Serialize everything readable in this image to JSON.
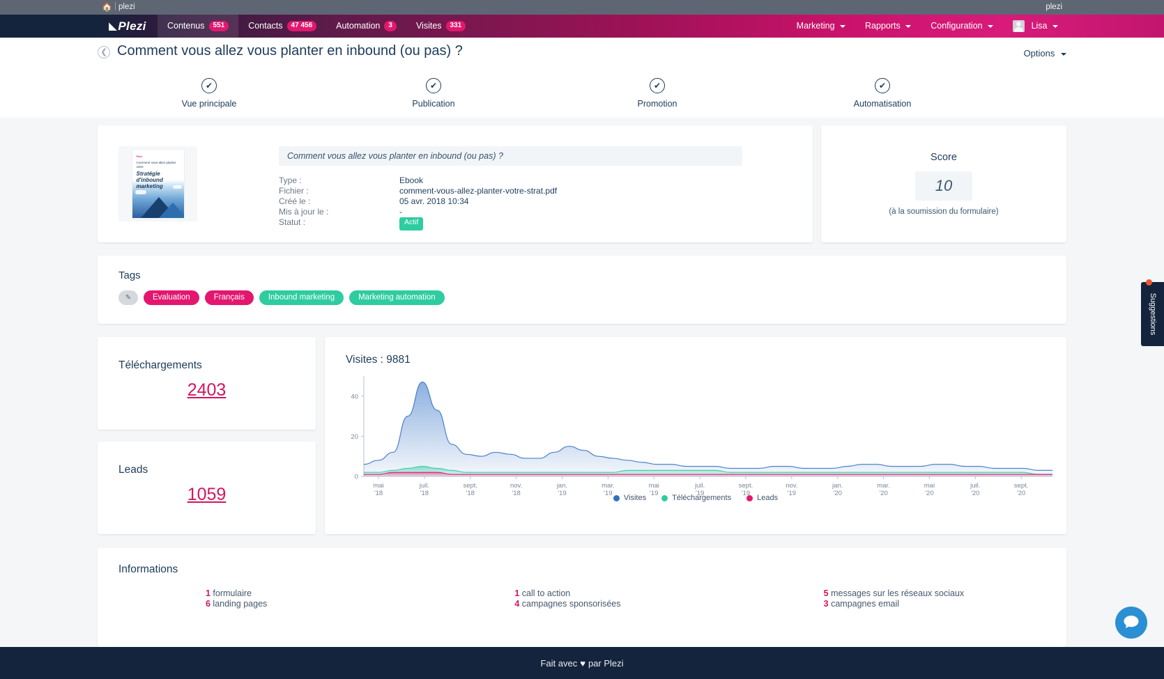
{
  "utilbar": {
    "home_icon": "home-icon",
    "account": "plezi",
    "account_right": "plezi"
  },
  "navbar": {
    "brand": "Plezi",
    "items": [
      {
        "label": "Contenus",
        "badge": "551",
        "active": true
      },
      {
        "label": "Contacts",
        "badge": "47 456",
        "active": false
      },
      {
        "label": "Automation",
        "badge": "3",
        "active": false
      },
      {
        "label": "Visites",
        "badge": "331",
        "active": false
      }
    ],
    "right_items": [
      {
        "label": "Marketing"
      },
      {
        "label": "Rapports"
      },
      {
        "label": "Configuration"
      }
    ],
    "user": "Lisa"
  },
  "header": {
    "back_icon": "chevron-left-icon",
    "title": "Comment vous allez vous planter en inbound (ou pas) ?",
    "options_label": "Options"
  },
  "stepper": {
    "steps": [
      {
        "label": "Vue principale",
        "check": "✔",
        "active": true
      },
      {
        "label": "Publication",
        "check": "✔",
        "active": false
      },
      {
        "label": "Promotion",
        "check": "✔",
        "active": false
      },
      {
        "label": "Automatisation",
        "check": "✔",
        "active": false
      }
    ]
  },
  "detail": {
    "title_field": "Comment vous allez vous planter en inbound (ou pas) ?",
    "thumbnail": {
      "brand": "Plezi",
      "line1": "Comment vous allez planter votre",
      "line2": "Stratégie d'inbound marketing",
      "line3": "ou pas ..."
    },
    "meta": [
      {
        "key": "Type :",
        "value": "Ebook"
      },
      {
        "key": "Fichier :",
        "value": "comment-vous-allez-planter-votre-strat.pdf"
      },
      {
        "key": "Créé le :",
        "value": "05 avr. 2018 10:34"
      },
      {
        "key": "Mis à jour le :",
        "value": "-"
      },
      {
        "key": "Statut :",
        "value": "Actif"
      }
    ],
    "status_badge": "Actif"
  },
  "score": {
    "title": "Score",
    "value": "10",
    "note": "(à la soumission du formulaire)"
  },
  "tags": {
    "title": "Tags",
    "edit_icon": "edit-icon",
    "items": [
      {
        "label": "Evaluation",
        "color": "#e3176f"
      },
      {
        "label": "Français",
        "color": "#e3176f"
      },
      {
        "label": "Inbound marketing",
        "color": "#2ecca0"
      },
      {
        "label": "Marketing automation",
        "color": "#2ecca0"
      }
    ]
  },
  "stats": {
    "downloads": {
      "title": "Téléchargements",
      "value": "2403"
    },
    "leads": {
      "title": "Leads",
      "value": "1059"
    }
  },
  "chart_data": {
    "type": "area",
    "title": "Visites : 9881",
    "xlabel": "",
    "ylabel": "",
    "ylim": [
      0,
      50
    ],
    "yticks": [
      0,
      20,
      40
    ],
    "grid": false,
    "legend_position": "bottom",
    "x_tick_labels": [
      "mai '18",
      "juil. '18",
      "sept. '18",
      "nov. '18",
      "jan. '19",
      "mar. '19",
      "mai '19",
      "juil. '19",
      "sept. '19",
      "nov. '19",
      "jan. '20",
      "mar. '20",
      "mai '20",
      "juil. '20",
      "sept. '20"
    ],
    "x_tick_lines": [
      [
        "mai",
        "'18"
      ],
      [
        "juil.",
        "'18"
      ],
      [
        "sept.",
        "'18"
      ],
      [
        "nov.",
        "'18"
      ],
      [
        "jan.",
        "'19"
      ],
      [
        "mar.",
        "'19"
      ],
      [
        "mai",
        "'19"
      ],
      [
        "juil.",
        "'19"
      ],
      [
        "sept.",
        "'19"
      ],
      [
        "nov.",
        "'19"
      ],
      [
        "jan.",
        "'20"
      ],
      [
        "mar.",
        "'20"
      ],
      [
        "mai",
        "'20"
      ],
      [
        "juil.",
        "'20"
      ],
      [
        "sept.",
        "'20"
      ]
    ],
    "series": [
      {
        "name": "Visites",
        "color": "#2f6fc4",
        "values": [
          6,
          8,
          12,
          30,
          47,
          33,
          16,
          11,
          10,
          12,
          11,
          9,
          9,
          12,
          15,
          13,
          10,
          9,
          8,
          7,
          6,
          6,
          5,
          5,
          5,
          4,
          4,
          4,
          5,
          5,
          4,
          4,
          4,
          5,
          6,
          6,
          5,
          5,
          5,
          6,
          6,
          5,
          5,
          4,
          4,
          4,
          3,
          3
        ]
      },
      {
        "name": "Téléchargements",
        "color": "#2ecca0",
        "values": [
          2,
          2,
          3,
          4,
          5,
          4,
          3,
          2,
          2,
          2,
          2,
          2,
          2,
          2,
          2,
          2,
          2,
          2,
          3,
          3,
          3,
          3,
          3,
          3,
          3,
          2,
          2,
          2,
          2,
          2,
          2,
          2,
          2,
          2,
          2,
          2,
          2,
          2,
          2,
          2,
          2,
          2,
          2,
          2,
          2,
          2,
          1,
          1
        ]
      },
      {
        "name": "Leads",
        "color": "#e3176f",
        "values": [
          1,
          1,
          2,
          2,
          2,
          2,
          1,
          1,
          1,
          1,
          1,
          1,
          1,
          1,
          1,
          1,
          1,
          1,
          1,
          1,
          1,
          1,
          1,
          1,
          1,
          1,
          1,
          1,
          1,
          1,
          1,
          1,
          1,
          1,
          1,
          1,
          1,
          1,
          1,
          1,
          1,
          1,
          1,
          1,
          1,
          1,
          1,
          1
        ]
      }
    ],
    "legend": [
      "Visites",
      "Téléchargements",
      "Leads"
    ]
  },
  "informations": {
    "title": "Informations",
    "columns": [
      [
        {
          "num": "1",
          "text": " formulaire"
        },
        {
          "num": "6",
          "text": " landing pages"
        }
      ],
      [
        {
          "num": "1",
          "text": " call to action"
        },
        {
          "num": "4",
          "text": " campagnes sponsorisées"
        }
      ],
      [
        {
          "num": "5",
          "text": " messages sur les réseaux sociaux"
        },
        {
          "num": "3",
          "text": " campagnes email"
        }
      ]
    ]
  },
  "footer": {
    "prefix": "Fait avec ",
    "heart": "♥",
    "suffix": " par Plezi"
  },
  "suggestions": {
    "label": "Suggestions"
  },
  "chat": {
    "icon": "chat-icon"
  }
}
